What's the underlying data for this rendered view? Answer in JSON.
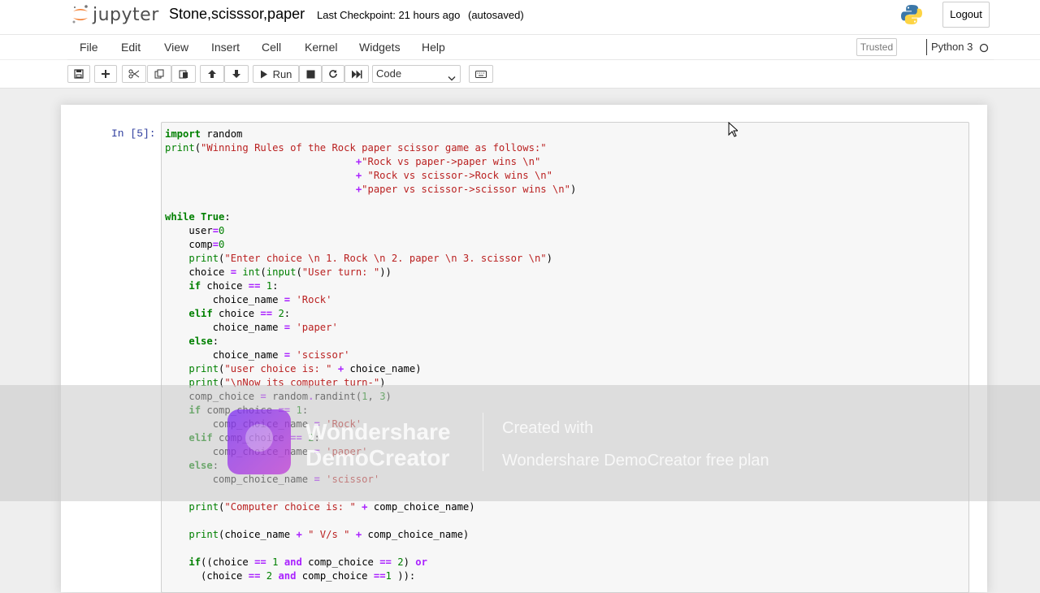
{
  "header": {
    "logo_text": "jupyter",
    "notebook_name": "Stone,scisssor,paper",
    "checkpoint": "Last Checkpoint: 21 hours ago",
    "autosave_status": "(autosaved)",
    "logout_label": "Logout"
  },
  "menubar": {
    "items": [
      "File",
      "Edit",
      "View",
      "Insert",
      "Cell",
      "Kernel",
      "Widgets",
      "Help"
    ],
    "trusted_label": "Trusted",
    "kernel_name": "Python 3"
  },
  "toolbar": {
    "run_label": "Run",
    "cell_type": "Code"
  },
  "cell": {
    "prompt": "In [5]:"
  },
  "watermark": {
    "brand_line1": "Wondershare",
    "brand_line2": "DemoCreator",
    "text_line1": "Created with",
    "text_line2": "Wondershare DemoCreator free plan"
  },
  "colors": {
    "keyword": "#008000",
    "string": "#ba2121",
    "prompt": "#303f9f"
  }
}
